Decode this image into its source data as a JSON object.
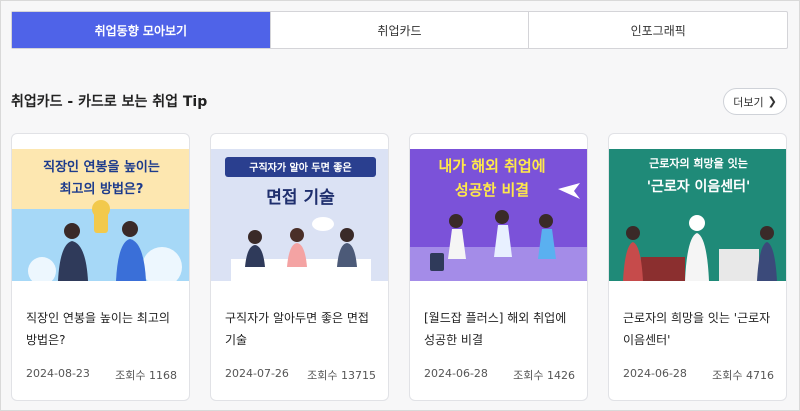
{
  "tabs": [
    {
      "label": "취업동향 모아보기",
      "active": true
    },
    {
      "label": "취업카드",
      "active": false
    },
    {
      "label": "인포그래픽",
      "active": false
    }
  ],
  "section": {
    "title": "취업카드 - 카드로 보는 취업 Tip",
    "more_label": "더보기"
  },
  "cards": [
    {
      "thumb_line1": "직장인 연봉을 높이는",
      "thumb_line2": "최고의 방법은?",
      "title": "직장인 연봉을 높이는 최고의 방법은?",
      "date": "2024-08-23",
      "views": "조회수 1168",
      "bg": "#9fd4f5"
    },
    {
      "thumb_line1": "구직자가 알아 두면 좋은",
      "thumb_line2": "면접 기술",
      "title": "구직자가 알아두면 좋은 면접 기술",
      "date": "2024-07-26",
      "views": "조회수 13715",
      "bg": "#d8dff3"
    },
    {
      "thumb_line1": "내가 해외 취업에",
      "thumb_line2": "성공한 비결",
      "title": "[월드잡 플러스] 해외 취업에 성공한 비결",
      "date": "2024-06-28",
      "views": "조회수 1426",
      "bg": "#7b4fd6"
    },
    {
      "thumb_line1": "근로자의 희망을 잇는",
      "thumb_line2": "'근로자 이음센터'",
      "title": "근로자의 희망을 잇는 '근로자 이음센터'",
      "date": "2024-06-28",
      "views": "조회수 4716",
      "bg": "#1f8a78"
    }
  ],
  "colors": {
    "accent": "#4f63e8"
  }
}
